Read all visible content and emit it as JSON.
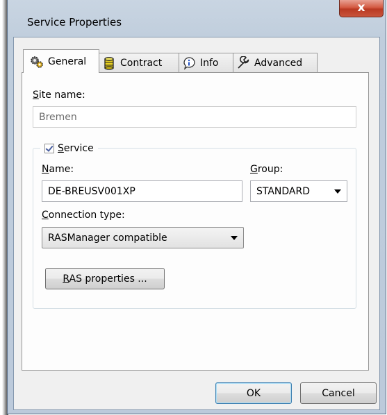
{
  "window": {
    "title": "Service Properties",
    "close_glyph": "x"
  },
  "tabs": [
    {
      "label": "General",
      "icon": "gears-icon",
      "active": true
    },
    {
      "label": "Contract",
      "icon": "database-icon",
      "active": false
    },
    {
      "label": "Info",
      "icon": "info-bubble-icon",
      "active": false
    },
    {
      "label": "Advanced",
      "icon": "wrench-icon",
      "active": false
    }
  ],
  "general": {
    "site_name": {
      "label_mnemonic": "S",
      "label_rest": "ite name:",
      "value": "Bremen",
      "enabled": false
    },
    "service_group": {
      "checkbox_checked": true,
      "label_mnemonic": "S",
      "label_rest": "ervice",
      "name": {
        "label_mnemonic": "N",
        "label_rest": "ame:",
        "value": "DE-BREUSV001XP"
      },
      "group": {
        "label_mnemonic": "G",
        "label_rest": "roup:",
        "selected": "STANDARD"
      },
      "connection_type": {
        "label_mnemonic": "C",
        "label_rest": "onnection type:",
        "selected": "RASManager compatible"
      },
      "ras_button": {
        "label_mnemonic": "R",
        "label_rest": "AS properties ..."
      }
    }
  },
  "buttons": {
    "ok": "OK",
    "cancel": "Cancel"
  },
  "colors": {
    "frame": "#bfcddc",
    "close_button": "#c8452e",
    "dialog_face": "#f0f0f0",
    "panel": "#fdfdfd"
  }
}
